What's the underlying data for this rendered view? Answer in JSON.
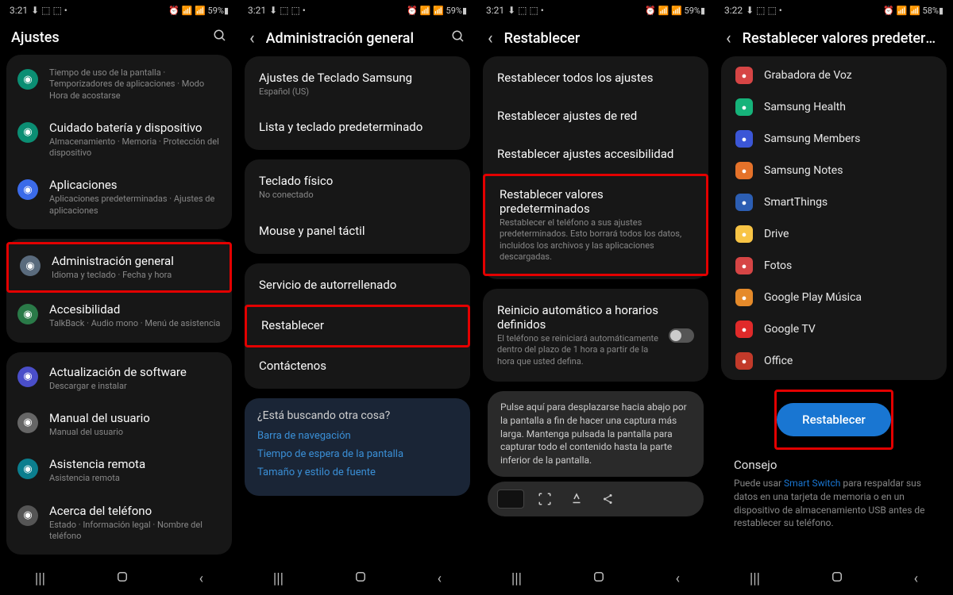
{
  "phones": [
    {
      "status": {
        "time": "3:21",
        "right": "59%"
      },
      "header": {
        "title": "Ajustes",
        "back": false,
        "search": true
      },
      "groups": [
        {
          "items": [
            {
              "icon": "#0b8e73",
              "title": "",
              "sub": "Tiempo de uso de la pantalla  ·  Temporizadores de aplicaciones  ·  Modo Hora de acostarse"
            },
            {
              "icon": "#0b8e73",
              "title": "Cuidado batería y dispositivo",
              "sub": "Almacenamiento  ·  Memoria  ·  Protección del dispositivo"
            },
            {
              "icon": "#3b6be9",
              "title": "Aplicaciones",
              "sub": "Aplicaciones predeterminadas  ·  Ajustes de aplicaciones"
            }
          ]
        },
        {
          "items": [
            {
              "icon": "#5a6b7d",
              "title": "Administración general",
              "sub": "Idioma y teclado  ·  Fecha y hora",
              "hl": true
            },
            {
              "icon": "#2a7a48",
              "title": "Accesibilidad",
              "sub": "TalkBack  ·  Audio mono  ·  Menú de asistencia"
            }
          ]
        },
        {
          "items": [
            {
              "icon": "#4a4ec9",
              "title": "Actualización de software",
              "sub": "Descargar e instalar"
            },
            {
              "icon": "#666",
              "title": "Manual del usuario",
              "sub": "Manual del usuario"
            },
            {
              "icon": "#0b7e8e",
              "title": "Asistencia remota",
              "sub": "Asistencia remota"
            },
            {
              "icon": "#555",
              "title": "Acerca del teléfono",
              "sub": "Estado  ·  Información legal  ·  Nombre del teléfono"
            }
          ]
        }
      ]
    },
    {
      "status": {
        "time": "3:21",
        "right": "59%"
      },
      "header": {
        "title": "Administración general",
        "back": true,
        "search": true
      },
      "groups": [
        {
          "plain": [
            {
              "title": "Ajustes de Teclado Samsung",
              "sub": "Español (US)",
              "blue": true
            },
            {
              "title": "Lista y teclado predeterminado"
            }
          ]
        },
        {
          "plain": [
            {
              "title": "Teclado físico",
              "sub": "No conectado"
            },
            {
              "title": "Mouse y panel táctil"
            }
          ]
        },
        {
          "plain": [
            {
              "title": "Servicio de autorrellenado"
            },
            {
              "title": "Restablecer",
              "hl": true
            },
            {
              "title": "Contáctenos"
            }
          ]
        }
      ],
      "looking": {
        "q": "¿Está buscando otra cosa?",
        "links": [
          "Barra de navegación",
          "Tiempo de espera de la pantalla",
          "Tamaño y estilo de fuente"
        ]
      }
    },
    {
      "status": {
        "time": "3:21",
        "right": "59%"
      },
      "header": {
        "title": "Restablecer",
        "back": true,
        "search": false
      },
      "groups": [
        {
          "plain": [
            {
              "title": "Restablecer todos los ajustes"
            },
            {
              "title": "Restablecer ajustes de red"
            },
            {
              "title": "Restablecer ajustes accesibilidad"
            },
            {
              "title": "Restablecer valores predeterminados",
              "sub": "Restablecer el teléfono a sus ajustes predeterminados. Esto borrará todos los datos, incluidos los archivos y las aplicaciones descargadas.",
              "hl": true
            }
          ]
        },
        {
          "plain": [
            {
              "title": "Reinicio automático a horarios definidos",
              "sub": "El teléfono se reiniciará automáticamente dentro del plazo de 1 hora a partir de la hora que usted defina.",
              "toggle": true
            }
          ]
        }
      ],
      "tooltip": "Pulse aquí para desplazarse hacia abajo por la pantalla a fin de hacer una captura más larga. Mantenga pulsada la pantalla para capturar todo el contenido hasta la parte inferior de la pantalla.",
      "capture": true
    },
    {
      "status": {
        "time": "3:22",
        "right": "58%"
      },
      "header": {
        "title": "Restablecer valores predeterminados",
        "back": true,
        "search": false
      },
      "apps": [
        {
          "color": "#d64545",
          "name": "Grabadora de Voz"
        },
        {
          "color": "#16b37a",
          "name": "Samsung Health"
        },
        {
          "color": "#3b56d6",
          "name": "Samsung Members"
        },
        {
          "color": "#e5722a",
          "name": "Samsung Notes"
        },
        {
          "color": "#2c5eb3",
          "name": "SmartThings"
        },
        {
          "color": "#f8c445",
          "name": "Drive"
        },
        {
          "color": "#d64545",
          "name": "Fotos"
        },
        {
          "color": "#e58a2a",
          "name": "Google Play Música"
        },
        {
          "color": "#e02a2a",
          "name": "Google TV"
        },
        {
          "color": "#c23a2a",
          "name": "Office"
        }
      ],
      "reset_btn": "Restablecer",
      "reset_hl": true,
      "tip": {
        "h": "Consejo",
        "t1": "Puede usar ",
        "lnk": "Smart Switch",
        "t2": " para respaldar sus datos en una tarjeta de memoria o en un dispositivo de almacenamiento USB antes de restablecer su teléfono."
      }
    }
  ],
  "status_icons": "⏰ 📶 📶 ",
  "battery_icon": "▮"
}
